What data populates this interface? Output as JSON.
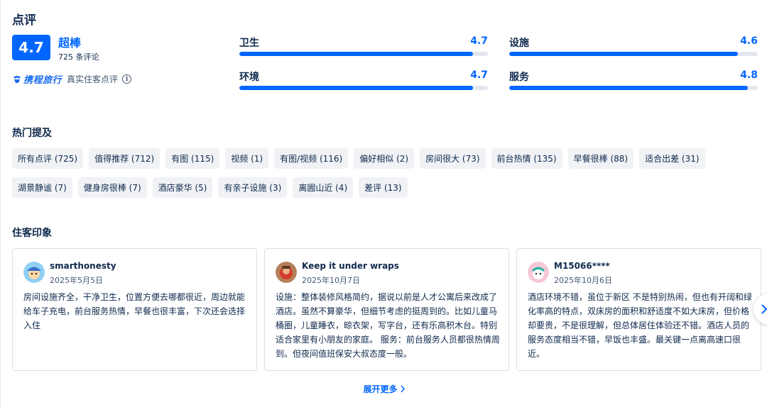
{
  "section": {
    "title": "点评"
  },
  "overall": {
    "score": "4.7",
    "word": "超棒",
    "count": "725",
    "count_suffix": "条评论"
  },
  "brand": {
    "logo_text": "携程旅行",
    "text": "真实住客点评",
    "info_icon": "info-icon"
  },
  "metrics": [
    {
      "label": "卫生",
      "value": "4.7",
      "fill": 0.94
    },
    {
      "label": "设施",
      "value": "4.6",
      "fill": 0.92
    },
    {
      "label": "环境",
      "value": "4.7",
      "fill": 0.94
    },
    {
      "label": "服务",
      "value": "4.8",
      "fill": 0.96
    }
  ],
  "hot_mentions": {
    "title": "热门提及",
    "tags": [
      "所有点评 (725)",
      "值得推荐 (712)",
      "有图 (115)",
      "视频 (1)",
      "有图/视频 (116)",
      "偏好相似 (2)",
      "房间很大 (73)",
      "前台热情 (135)",
      "早餐很棒 (88)",
      "适合出差 (31)",
      "湖景静谧 (7)",
      "健身房很棒 (7)",
      "酒店豪华 (5)",
      "有亲子设施 (3)",
      "离圌山近 (4)",
      "差评 (13)"
    ]
  },
  "impressions": {
    "title": "住客印象",
    "reviews": [
      {
        "name": "smarthonesty",
        "date": "2025年5月5日",
        "text": "房间设施齐全，干净卫生，位置方便去哪都很近，周边就能给车子充电，前台服务热情，早餐也很丰富，下次还会选择入住"
      },
      {
        "name": "Keep it under wraps",
        "date": "2025年10月7日",
        "text": "设施：整体装修风格简约，据说以前是人才公寓后来改成了酒店。虽然不算豪华，但细节考虑的挺周到的。比如儿童马桶圈，儿童睡衣，晾衣架，写字台，还有乐高积木台。特别适合家里有小朋友的家庭。 服务：前台服务人员都很热情周到。但夜间值班保安大叔态度一般。"
      },
      {
        "name": "M15066****",
        "date": "2025年10月6日",
        "text": "酒店环境不错，虽位于新区 不是特别热闹，但也有开阔和绿化率高的特点，双床房的面积和舒适度不如大床房，但价格却要贵，不是很理解，但总体居住体验还不错。酒店人员的服务态度相当不错，早饭也丰盛。最关键一点离高速口很近。"
      }
    ]
  },
  "more": {
    "label": "展开更多"
  },
  "colors": {
    "accent": "#0066ff",
    "text": "#0f294d",
    "tag_bg": "#f0f2f5"
  }
}
